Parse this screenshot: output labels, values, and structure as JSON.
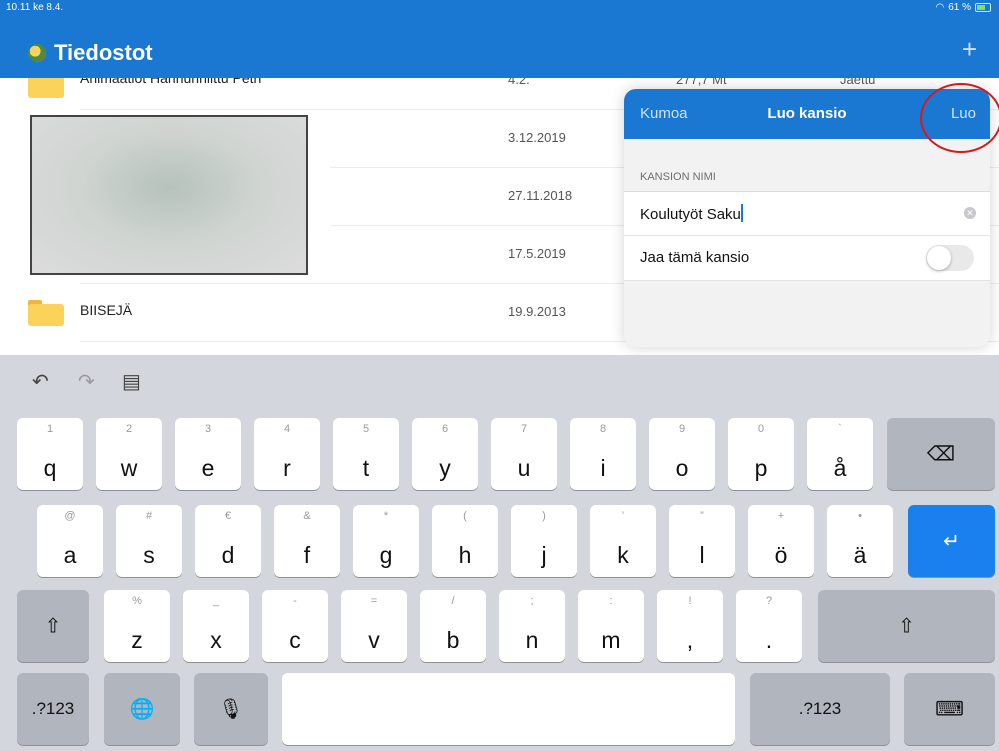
{
  "status": {
    "time": "10.11",
    "date": "ke 8.4.",
    "battery": "61 %"
  },
  "header": {
    "title": "Tiedostot",
    "add_icon": "+"
  },
  "files": [
    {
      "name": "Animaatiot Hannunniittu Petri",
      "date": "4.2.",
      "size": "277,7 Mt",
      "share": "Jaettu"
    },
    {
      "name": "",
      "date": "3.12.2019"
    },
    {
      "name": "",
      "date": "27.11.2018"
    },
    {
      "name": "",
      "date": "17.5.2019"
    },
    {
      "name": "BIISEJÄ",
      "date": "19.9.2013"
    }
  ],
  "dialog": {
    "cancel": "Kumoa",
    "title": "Luo kansio",
    "create": "Luo",
    "section_label": "KANSION NIMI",
    "folder_name": "Koulutyöt Saku",
    "share_label": "Jaa tämä kansio",
    "share_enabled": false
  },
  "keyboard": {
    "row1": [
      {
        "main": "q",
        "alt": "1"
      },
      {
        "main": "w",
        "alt": "2"
      },
      {
        "main": "e",
        "alt": "3"
      },
      {
        "main": "r",
        "alt": "4"
      },
      {
        "main": "t",
        "alt": "5"
      },
      {
        "main": "y",
        "alt": "6"
      },
      {
        "main": "u",
        "alt": "7"
      },
      {
        "main": "i",
        "alt": "8"
      },
      {
        "main": "o",
        "alt": "9"
      },
      {
        "main": "p",
        "alt": "0"
      },
      {
        "main": "å",
        "alt": "`"
      }
    ],
    "row2": [
      {
        "main": "a",
        "alt": "@"
      },
      {
        "main": "s",
        "alt": "#"
      },
      {
        "main": "d",
        "alt": "€"
      },
      {
        "main": "f",
        "alt": "&"
      },
      {
        "main": "g",
        "alt": "*"
      },
      {
        "main": "h",
        "alt": "("
      },
      {
        "main": "j",
        "alt": ")"
      },
      {
        "main": "k",
        "alt": "’"
      },
      {
        "main": "l",
        "alt": "”"
      },
      {
        "main": "ö",
        "alt": "+"
      },
      {
        "main": "ä",
        "alt": "•"
      }
    ],
    "row3": [
      {
        "main": "z",
        "alt": "%"
      },
      {
        "main": "x",
        "alt": "_"
      },
      {
        "main": "c",
        "alt": "-"
      },
      {
        "main": "v",
        "alt": "="
      },
      {
        "main": "b",
        "alt": "/"
      },
      {
        "main": "n",
        "alt": ";"
      },
      {
        "main": "m",
        "alt": ":"
      },
      {
        "main": ",",
        "alt": "!"
      },
      {
        "main": ".",
        "alt": "?"
      }
    ],
    "numbers_label": ".?123",
    "icons": {
      "undo": "↶",
      "redo": "↷",
      "paste": "▤",
      "backspace": "⌫",
      "return": "↵",
      "shift": "⇧",
      "globe": "🌐",
      "mic": "🎙",
      "hide": "⌨"
    }
  }
}
